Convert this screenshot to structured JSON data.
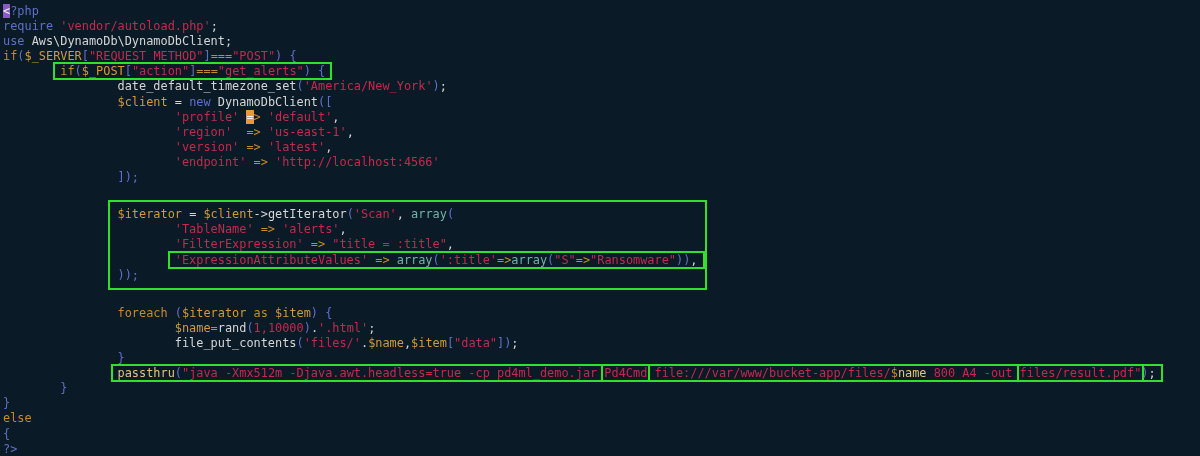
{
  "editor": {
    "code": [
      {
        "kind": "line",
        "items": [
          {
            "kind": "cursor",
            "text": "<",
            "color": "#8a5cc0"
          },
          {
            "kind": "kw",
            "text": "?php"
          }
        ]
      },
      {
        "kind": "line",
        "items": [
          {
            "kind": "kw",
            "text": "require "
          },
          {
            "kind": "str",
            "text": "'vendor/autoload.php'"
          },
          {
            "kind": "plain",
            "text": ";"
          }
        ]
      },
      {
        "kind": "line",
        "items": [
          {
            "kind": "kw",
            "text": "use "
          },
          {
            "kind": "plain",
            "text": "Aws\\DynamoDb\\DynamoDbClient;"
          }
        ]
      },
      {
        "kind": "line",
        "items": [
          {
            "kind": "ctl",
            "text": "if"
          },
          {
            "kind": "kw",
            "text": "("
          },
          {
            "kind": "var",
            "text": "$_SERVER"
          },
          {
            "kind": "kw",
            "text": "["
          },
          {
            "kind": "str",
            "text": "\"REQUEST_METHOD\""
          },
          {
            "kind": "kw",
            "text": "]"
          },
          {
            "kind": "op",
            "text": "==="
          },
          {
            "kind": "str",
            "text": "\"POST\""
          },
          {
            "kind": "kw",
            "text": ") {"
          }
        ]
      },
      {
        "kind": "block",
        "children": [
          {
            "kind": "line",
            "items": [
              {
                "kind": "box",
                "items": [
                  {
                    "kind": "ctl",
                    "text": "if"
                  },
                  {
                    "kind": "kw",
                    "text": "("
                  },
                  {
                    "kind": "var",
                    "text": "$_POST"
                  },
                  {
                    "kind": "kw",
                    "text": "["
                  },
                  {
                    "kind": "str",
                    "text": "\"action\""
                  },
                  {
                    "kind": "kw",
                    "text": "]"
                  },
                  {
                    "kind": "op",
                    "text": "==="
                  },
                  {
                    "kind": "str",
                    "text": "\"get_alerts\""
                  },
                  {
                    "kind": "kw",
                    "text": ") {"
                  }
                ]
              }
            ]
          },
          {
            "kind": "block",
            "children": [
              {
                "kind": "line",
                "items": [
                  {
                    "kind": "plain",
                    "text": "date_default_timezone_set"
                  },
                  {
                    "kind": "kw",
                    "text": "("
                  },
                  {
                    "kind": "str",
                    "text": "'America/New_York'"
                  },
                  {
                    "kind": "kw",
                    "text": ")"
                  },
                  {
                    "kind": "plain",
                    "text": ";"
                  }
                ]
              },
              {
                "kind": "line",
                "items": [
                  {
                    "kind": "var",
                    "text": "$client"
                  },
                  {
                    "kind": "plain",
                    "text": " = "
                  },
                  {
                    "kind": "kw",
                    "text": "new "
                  },
                  {
                    "kind": "plain",
                    "text": "DynamoDbClient"
                  },
                  {
                    "kind": "kw",
                    "text": "(["
                  }
                ]
              },
              {
                "kind": "block",
                "children": [
                  {
                    "kind": "line",
                    "items": [
                      {
                        "kind": "str",
                        "text": "'profile' "
                      },
                      {
                        "kind": "cursor",
                        "text": "=",
                        "color": "#e8983a"
                      },
                      {
                        "kind": "op",
                        "text": "> "
                      },
                      {
                        "kind": "str",
                        "text": "'default'"
                      },
                      {
                        "kind": "plain",
                        "text": ","
                      }
                    ]
                  },
                  {
                    "kind": "line",
                    "items": [
                      {
                        "kind": "str",
                        "text": "'region'"
                      },
                      {
                        "kind": "op",
                        "text": "  => "
                      },
                      {
                        "kind": "str",
                        "text": "'us-east-1'"
                      },
                      {
                        "kind": "plain",
                        "text": ","
                      }
                    ]
                  },
                  {
                    "kind": "line",
                    "items": [
                      {
                        "kind": "str",
                        "text": "'version'"
                      },
                      {
                        "kind": "op",
                        "text": " => "
                      },
                      {
                        "kind": "str",
                        "text": "'latest'"
                      },
                      {
                        "kind": "plain",
                        "text": ","
                      }
                    ]
                  },
                  {
                    "kind": "line",
                    "items": [
                      {
                        "kind": "str",
                        "text": "'endpoint'"
                      },
                      {
                        "kind": "op",
                        "text": " => "
                      },
                      {
                        "kind": "str",
                        "text": "'http://localhost:4566'"
                      }
                    ]
                  }
                ]
              },
              {
                "kind": "line",
                "items": [
                  {
                    "kind": "kw",
                    "text": "]);"
                  }
                ]
              },
              {
                "kind": "blank"
              },
              {
                "kind": "boxed",
                "children": [
                  {
                    "kind": "line",
                    "items": [
                      {
                        "kind": "var",
                        "text": "$iterator"
                      },
                      {
                        "kind": "plain",
                        "text": " = "
                      },
                      {
                        "kind": "var",
                        "text": "$client"
                      },
                      {
                        "kind": "plain",
                        "text": "->getIterator"
                      },
                      {
                        "kind": "kw",
                        "text": "("
                      },
                      {
                        "kind": "str",
                        "text": "'Scan'"
                      },
                      {
                        "kind": "plain",
                        "text": ", "
                      },
                      {
                        "kind": "bi",
                        "text": "array"
                      },
                      {
                        "kind": "kw",
                        "text": "("
                      }
                    ]
                  },
                  {
                    "kind": "block",
                    "children": [
                      {
                        "kind": "line",
                        "items": [
                          {
                            "kind": "str",
                            "text": "'TableName'"
                          },
                          {
                            "kind": "op",
                            "text": " => "
                          },
                          {
                            "kind": "str",
                            "text": "'alerts'"
                          },
                          {
                            "kind": "plain",
                            "text": ","
                          }
                        ]
                      },
                      {
                        "kind": "line",
                        "items": [
                          {
                            "kind": "str",
                            "text": "'FilterExpression'"
                          },
                          {
                            "kind": "op",
                            "text": " => "
                          },
                          {
                            "kind": "str",
                            "text": "\"title = :title\""
                          },
                          {
                            "kind": "plain",
                            "text": ","
                          }
                        ]
                      },
                      {
                        "kind": "line",
                        "items": [
                          {
                            "kind": "box",
                            "items": [
                              {
                                "kind": "str",
                                "text": "'ExpressionAttributeValues'"
                              },
                              {
                                "kind": "op",
                                "text": " => "
                              },
                              {
                                "kind": "bi",
                                "text": "array"
                              },
                              {
                                "kind": "kw",
                                "text": "("
                              },
                              {
                                "kind": "str",
                                "text": "':title'"
                              },
                              {
                                "kind": "op",
                                "text": "=>"
                              },
                              {
                                "kind": "bi",
                                "text": "array"
                              },
                              {
                                "kind": "kw",
                                "text": "("
                              },
                              {
                                "kind": "str",
                                "text": "\"S\""
                              },
                              {
                                "kind": "op",
                                "text": "=>"
                              },
                              {
                                "kind": "str",
                                "text": "\"Ransomware\""
                              },
                              {
                                "kind": "kw",
                                "text": "))"
                              },
                              {
                                "kind": "plain",
                                "text": ","
                              }
                            ]
                          }
                        ]
                      }
                    ]
                  },
                  {
                    "kind": "line",
                    "items": [
                      {
                        "kind": "kw",
                        "text": "));"
                      }
                    ]
                  }
                ]
              },
              {
                "kind": "blank"
              },
              {
                "kind": "line",
                "items": [
                  {
                    "kind": "ctl",
                    "text": "foreach "
                  },
                  {
                    "kind": "kw",
                    "text": "("
                  },
                  {
                    "kind": "var",
                    "text": "$iterator"
                  },
                  {
                    "kind": "ctl",
                    "text": " as "
                  },
                  {
                    "kind": "var",
                    "text": "$item"
                  },
                  {
                    "kind": "kw",
                    "text": ") {"
                  }
                ]
              },
              {
                "kind": "block",
                "children": [
                  {
                    "kind": "line",
                    "items": [
                      {
                        "kind": "var",
                        "text": "$name"
                      },
                      {
                        "kind": "op",
                        "text": "="
                      },
                      {
                        "kind": "plain",
                        "text": "rand"
                      },
                      {
                        "kind": "kw",
                        "text": "("
                      },
                      {
                        "kind": "str",
                        "text": "1,10000"
                      },
                      {
                        "kind": "kw",
                        "text": ")"
                      },
                      {
                        "kind": "plain",
                        "text": "."
                      },
                      {
                        "kind": "str",
                        "text": "'.html'"
                      },
                      {
                        "kind": "plain",
                        "text": ";"
                      }
                    ]
                  },
                  {
                    "kind": "line",
                    "items": [
                      {
                        "kind": "plain",
                        "text": "file_put_contents"
                      },
                      {
                        "kind": "kw",
                        "text": "("
                      },
                      {
                        "kind": "str",
                        "text": "'files/'"
                      },
                      {
                        "kind": "plain",
                        "text": "."
                      },
                      {
                        "kind": "var",
                        "text": "$name"
                      },
                      {
                        "kind": "plain",
                        "text": ","
                      },
                      {
                        "kind": "var",
                        "text": "$item"
                      },
                      {
                        "kind": "kw",
                        "text": "["
                      },
                      {
                        "kind": "str",
                        "text": "\"data\""
                      },
                      {
                        "kind": "kw",
                        "text": "])"
                      },
                      {
                        "kind": "plain",
                        "text": ";"
                      }
                    ]
                  }
                ]
              },
              {
                "kind": "line",
                "items": [
                  {
                    "kind": "kw",
                    "text": "}"
                  }
                ]
              },
              {
                "kind": "line",
                "items": [
                  {
                    "kind": "box",
                    "items": [
                      {
                        "kind": "fn",
                        "text": "passthru"
                      },
                      {
                        "kind": "kw",
                        "text": "("
                      },
                      {
                        "kind": "str",
                        "text": "\"java -Xmx512m -Djava.awt.headless=true -cp pd4ml_demo.jar "
                      },
                      {
                        "kind": "box",
                        "items": [
                          {
                            "kind": "str",
                            "text": "Pd4Cmd"
                          }
                        ]
                      },
                      {
                        "kind": "str",
                        "text": " file:///var/www/bucket-app/files/"
                      },
                      {
                        "kind": "op",
                        "text": "$"
                      },
                      {
                        "kind": "fn",
                        "text": "name"
                      },
                      {
                        "kind": "str",
                        "text": " 800 A4 -out "
                      },
                      {
                        "kind": "box",
                        "items": [
                          {
                            "kind": "str",
                            "text": "files/result.pdf\""
                          }
                        ]
                      },
                      {
                        "kind": "kw",
                        "text": ")"
                      },
                      {
                        "kind": "plain",
                        "text": ";"
                      }
                    ]
                  }
                ]
              }
            ]
          },
          {
            "kind": "line",
            "items": [
              {
                "kind": "kw",
                "text": "}"
              }
            ]
          }
        ]
      },
      {
        "kind": "line",
        "items": [
          {
            "kind": "kw",
            "text": "}"
          }
        ]
      },
      {
        "kind": "line",
        "items": [
          {
            "kind": "ctl",
            "text": "else"
          }
        ]
      },
      {
        "kind": "line",
        "items": [
          {
            "kind": "kw",
            "text": "{"
          }
        ]
      },
      {
        "kind": "line",
        "items": [
          {
            "kind": "kw",
            "text": "?>"
          }
        ]
      }
    ]
  }
}
